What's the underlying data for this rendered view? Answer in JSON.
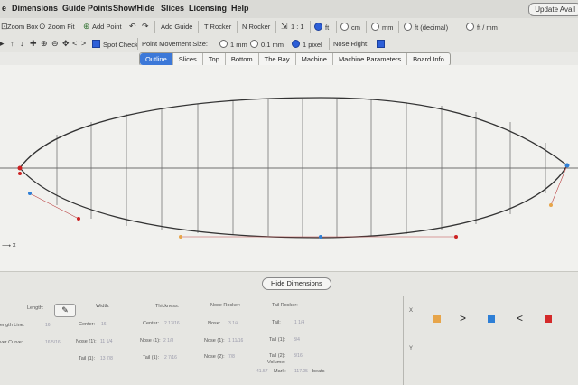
{
  "menu": {
    "items": [
      "e",
      "Dimensions",
      "Guide Points",
      "Show/Hide",
      "Slices",
      "Licensing",
      "Help"
    ],
    "update_button": "Update Avail"
  },
  "toolbar1": {
    "zoom_box": "Zoom Box",
    "zoom_fit": "Zoom Fit",
    "add_point": "Add Point",
    "add_guide": "Add Guide",
    "t_rocker": "T Rocker",
    "n_rocker": "N Rocker",
    "scale": "1 : 1",
    "unit_ft": "ft",
    "unit_cm": "cm",
    "unit_mm": "mm",
    "unit_ft_decimal": "ft (decimal)",
    "unit_ft_mm": "ft / mm"
  },
  "toolbar2": {
    "spot_check": "Spot Check",
    "point_movement_label": "Point Movement Size:",
    "move_1mm": "1 mm",
    "move_01mm": "0.1 mm",
    "move_1px": "1 pixel",
    "nose_right": "Nose Right:"
  },
  "tabs": [
    "Outline",
    "Slices",
    "Top",
    "Bottom",
    "The Bay",
    "Machine",
    "Machine Parameters",
    "Board Info"
  ],
  "active_tab": "Outline",
  "canvas": {
    "x_axis_label": "x"
  },
  "dimensions": {
    "hide_button": "Hide Dimensions",
    "length_label": "Length:",
    "width_label": "Width:",
    "thickness_label": "Thickness:",
    "nose_rocker_label": "Nose Rocker:",
    "tail_rocker_label": "Tail Rocker:",
    "overall_length_label": "ength Line:",
    "over_curve_label": "ver Curve:",
    "length_val": "16",
    "over_curve_val": "16  5/16",
    "center_label": "Center:",
    "center_val": "16",
    "nose1_label": "Nose (1):",
    "nose1_val": "11  1/4",
    "tail1_label": "Tail (1):",
    "tail1_val": "13  7/8",
    "thick_center_label": "Center:",
    "thick_center_val": "2  13/16",
    "thick_nose_label": "Nose (1):",
    "thick_nose_val": "2  1/8",
    "thick_tail_label": "Tail (1):",
    "thick_tail_val": "2  7/16",
    "nr_nose_label": "Nose:",
    "nr_nose_val": "3  1/4",
    "nr_nose1_label": "Nose (1):",
    "nr_nose1_val": "1  11/16",
    "nr_nose2_label": "Nose (2):",
    "nr_nose2_val": "7/8",
    "tr_tail_label": "Tail:",
    "tr_tail_val": "1  1/4",
    "tr_tail1_label": "Tail (1):",
    "tr_tail1_val": "3/4",
    "tr_tail2_label": "Tail (2):",
    "tr_tail2_val": "3/16",
    "volume_label": "Volume:",
    "volume_val": "41.57",
    "liters_label": "liters",
    "mark_label": "Mark:",
    "mark_val": "117.05",
    "beats_label": "beats",
    "x_label": "X",
    "y_label": "Y"
  },
  "side_panel": {
    "swatch_left": "#e7a54a",
    "arrow_right": ">",
    "swatch_mid": "#2e7fd6",
    "arrow_left": "<",
    "swatch_right": "#d42a2a"
  }
}
